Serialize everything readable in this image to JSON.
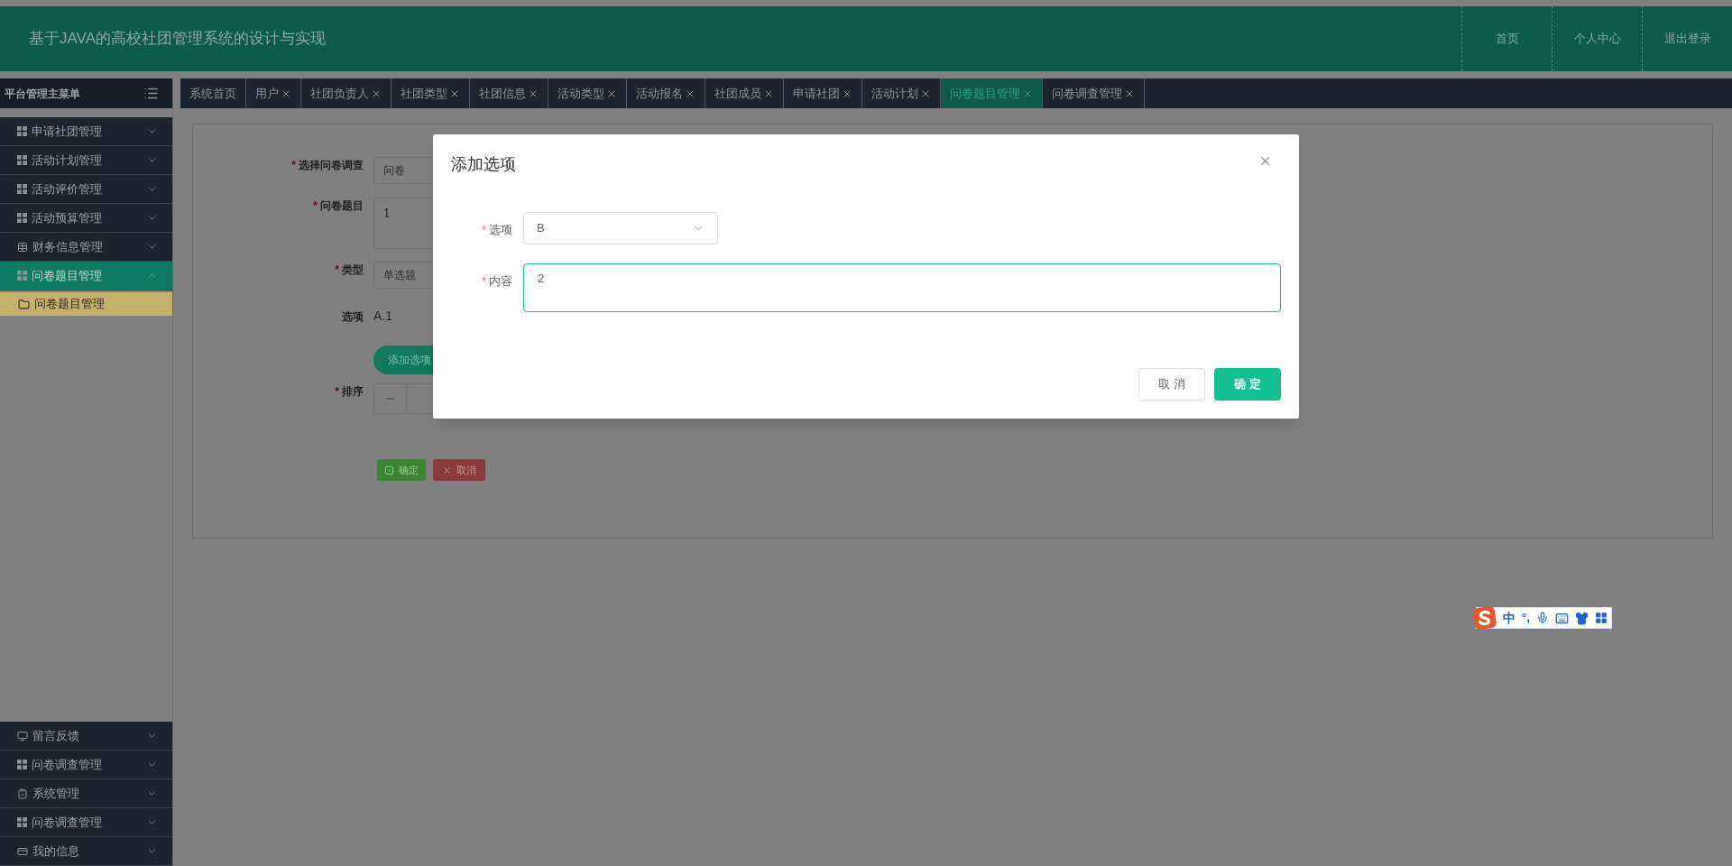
{
  "header": {
    "title": "基于JAVA的高校社团管理系统的设计与实现",
    "links": [
      {
        "label": "首页"
      },
      {
        "label": "个人中心"
      },
      {
        "label": "退出登录"
      }
    ]
  },
  "sidebar": {
    "title": "平台管理主菜单",
    "top_items": [
      {
        "label": "申请社团管理",
        "expanded": false,
        "selected": false
      },
      {
        "label": "活动计划管理",
        "expanded": false,
        "selected": false
      },
      {
        "label": "活动评价管理",
        "expanded": false,
        "selected": false
      },
      {
        "label": "活动预算管理",
        "expanded": false,
        "selected": false
      },
      {
        "label": "财务信息管理",
        "expanded": false,
        "selected": false
      },
      {
        "label": "问卷题目管理",
        "expanded": true,
        "selected": true,
        "children": [
          {
            "label": "问卷题目管理",
            "selected": true
          }
        ]
      }
    ],
    "bottom_items": [
      {
        "label": "留言反馈",
        "expanded": false,
        "selected": false
      },
      {
        "label": "问卷调查管理",
        "expanded": false,
        "selected": false
      },
      {
        "label": "系统管理",
        "expanded": false,
        "selected": false
      },
      {
        "label": "问卷调查管理",
        "expanded": false,
        "selected": false
      },
      {
        "label": "我的信息",
        "expanded": false,
        "selected": false
      }
    ]
  },
  "tabs": [
    {
      "label": "系统首页",
      "closable": false,
      "selected": false
    },
    {
      "label": "用户",
      "closable": true,
      "selected": false
    },
    {
      "label": "社团负责人",
      "closable": true,
      "selected": false
    },
    {
      "label": "社团类型",
      "closable": true,
      "selected": false
    },
    {
      "label": "社团信息",
      "closable": true,
      "selected": false
    },
    {
      "label": "活动类型",
      "closable": true,
      "selected": false
    },
    {
      "label": "活动报名",
      "closable": true,
      "selected": false
    },
    {
      "label": "社团成员",
      "closable": true,
      "selected": false
    },
    {
      "label": "申请社团",
      "closable": true,
      "selected": false
    },
    {
      "label": "活动计划",
      "closable": true,
      "selected": false
    },
    {
      "label": "问卷题目管理",
      "closable": true,
      "selected": true
    },
    {
      "label": "问卷调查管理",
      "closable": true,
      "selected": false
    }
  ],
  "form": {
    "fields": [
      {
        "kind": "select",
        "label": "选择问卷调查",
        "required_mark": "*",
        "value": "问卷"
      },
      {
        "kind": "textarea",
        "label": "问卷题目",
        "required_mark": "*",
        "value": "1"
      },
      {
        "kind": "select",
        "label": "类型",
        "required_mark": "*",
        "value": "单选题"
      },
      {
        "kind": "text",
        "label": "选项",
        "value": "A.1"
      },
      {
        "kind": "button",
        "label": "添加选项"
      },
      {
        "kind": "number",
        "label": "排序",
        "required_mark": "*"
      }
    ],
    "buttons": [
      {
        "kind": "confirm",
        "label": "确定"
      },
      {
        "kind": "cancel",
        "label": "取消"
      }
    ]
  },
  "dialog": {
    "title": "添加选项",
    "fields": [
      {
        "kind": "select",
        "label": "选项",
        "required_mark": "*",
        "value": "B"
      },
      {
        "kind": "textarea",
        "label": "内容",
        "required_mark": "*",
        "value": "2",
        "focused": true
      }
    ],
    "buttons": [
      {
        "kind": "cancel",
        "label": "取 消"
      },
      {
        "kind": "confirm",
        "label": "确 定"
      }
    ]
  },
  "ime": {
    "mode": "中",
    "punctuation": "°,"
  }
}
